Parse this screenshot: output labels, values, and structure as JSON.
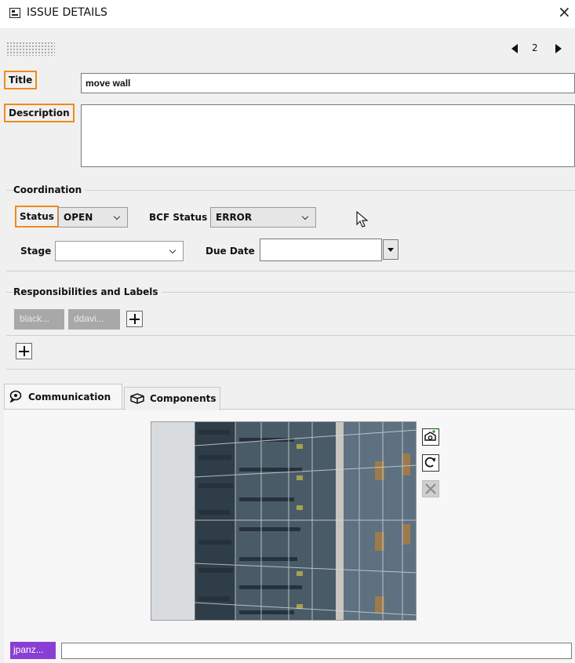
{
  "window": {
    "title": "ISSUE DETAILS",
    "close_glyph": "×"
  },
  "pager": {
    "current": "2"
  },
  "form": {
    "title_label": "Title",
    "title_value": "move wall",
    "description_label": "Description",
    "description_value": ""
  },
  "coordination": {
    "group_label": "Coordination",
    "status_label": "Status",
    "status_value": "OPEN",
    "bcf_status_label": "BCF Status",
    "bcf_status_value": "ERROR",
    "stage_label": "Stage",
    "stage_value": "",
    "due_date_label": "Due Date",
    "due_date_value": ""
  },
  "responsibilities": {
    "group_label": "Responsibilities and Labels",
    "chips": [
      "black...",
      "ddavi..."
    ]
  },
  "tabs": [
    {
      "label": "Communication",
      "icon": "chat-icon",
      "active": true
    },
    {
      "label": "Components",
      "icon": "component-icon",
      "active": false
    }
  ],
  "communication": {
    "author": "jpanz...",
    "comment_value": ""
  },
  "colors": {
    "highlight": "#f08a1c",
    "chip_bg": "#a8a8a8",
    "author_badge": "#8a3fd4"
  }
}
